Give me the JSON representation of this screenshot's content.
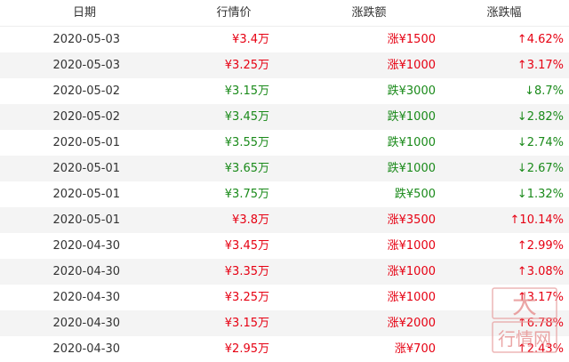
{
  "header": {
    "date": "日期",
    "price": "行情价",
    "change_amount": "涨跌额",
    "change_pct": "涨跌幅"
  },
  "rows": [
    {
      "date": "2020-05-03",
      "price": "¥3.4万",
      "amount": "涨¥1500",
      "pct": "↑4.62%",
      "dir": "up"
    },
    {
      "date": "2020-05-03",
      "price": "¥3.25万",
      "amount": "涨¥1000",
      "pct": "↑3.17%",
      "dir": "up"
    },
    {
      "date": "2020-05-02",
      "price": "¥3.15万",
      "amount": "跌¥3000",
      "pct": "↓8.7%",
      "dir": "down"
    },
    {
      "date": "2020-05-02",
      "price": "¥3.45万",
      "amount": "跌¥1000",
      "pct": "↓2.82%",
      "dir": "down"
    },
    {
      "date": "2020-05-01",
      "price": "¥3.55万",
      "amount": "跌¥1000",
      "pct": "↓2.74%",
      "dir": "down"
    },
    {
      "date": "2020-05-01",
      "price": "¥3.65万",
      "amount": "跌¥1000",
      "pct": "↓2.67%",
      "dir": "down"
    },
    {
      "date": "2020-05-01",
      "price": "¥3.75万",
      "amount": "跌¥500",
      "pct": "↓1.32%",
      "dir": "down"
    },
    {
      "date": "2020-05-01",
      "price": "¥3.8万",
      "amount": "涨¥3500",
      "pct": "↑10.14%",
      "dir": "up"
    },
    {
      "date": "2020-04-30",
      "price": "¥3.45万",
      "amount": "涨¥1000",
      "pct": "↑2.99%",
      "dir": "up"
    },
    {
      "date": "2020-04-30",
      "price": "¥3.35万",
      "amount": "涨¥1000",
      "pct": "↑3.08%",
      "dir": "up"
    },
    {
      "date": "2020-04-30",
      "price": "¥3.25万",
      "amount": "涨¥1000",
      "pct": "↑3.17%",
      "dir": "up"
    },
    {
      "date": "2020-04-30",
      "price": "¥3.15万",
      "amount": "涨¥2000",
      "pct": "↑6.78%",
      "dir": "up"
    },
    {
      "date": "2020-04-30",
      "price": "¥2.95万",
      "amount": "涨¥700",
      "pct": "↑2.43%",
      "dir": "up"
    }
  ],
  "colors": {
    "up": "#e60012",
    "down": "#1a8a1a",
    "stripe": "#f4f4f4"
  },
  "watermark": {
    "top_text": "大",
    "bottom_text": "行情网"
  }
}
